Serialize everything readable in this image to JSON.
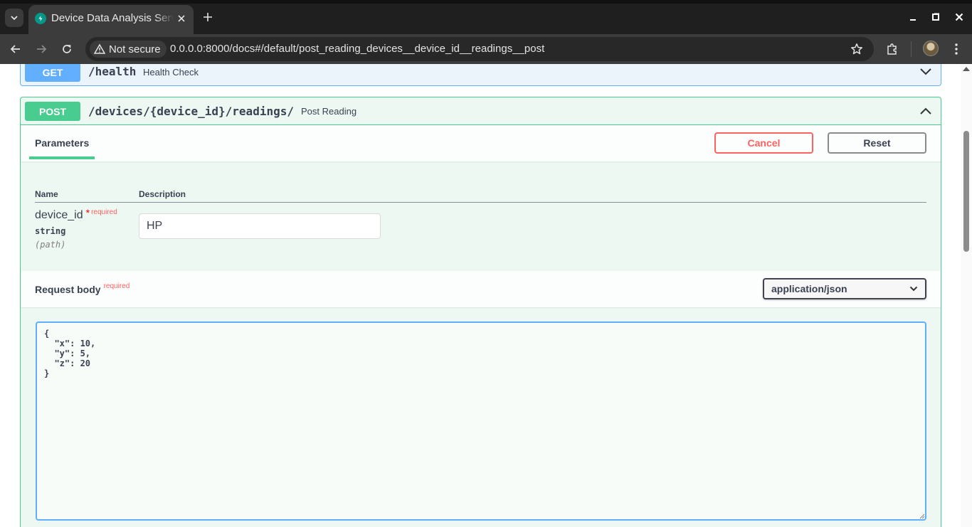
{
  "browser": {
    "tab_title": "Device Data Analysis Service",
    "security_label": "Not secure",
    "url": "0.0.0.0:8000/docs#/default/post_reading_devices__device_id__readings__post"
  },
  "get_operation": {
    "method": "GET",
    "path": "/health",
    "summary": "Health Check"
  },
  "post_operation": {
    "method": "POST",
    "path": "/devices/{device_id}/readings/",
    "summary": "Post Reading",
    "parameters_tab": "Parameters",
    "cancel_label": "Cancel",
    "reset_label": "Reset",
    "columns": {
      "name": "Name",
      "description": "Description"
    },
    "parameter": {
      "name": "device_id",
      "required_star": "*",
      "required_label": "required",
      "type": "string",
      "location": "(path)",
      "value": "HP"
    },
    "request_body": {
      "title": "Request body",
      "required_label": "required",
      "content_type": "application/json",
      "value": "{\n  \"x\": 10,\n  \"y\": 5,\n  \"z\": 20\n}"
    }
  },
  "colors": {
    "get": "#61affe",
    "post": "#49cc90",
    "cancel": "#ff6060"
  }
}
